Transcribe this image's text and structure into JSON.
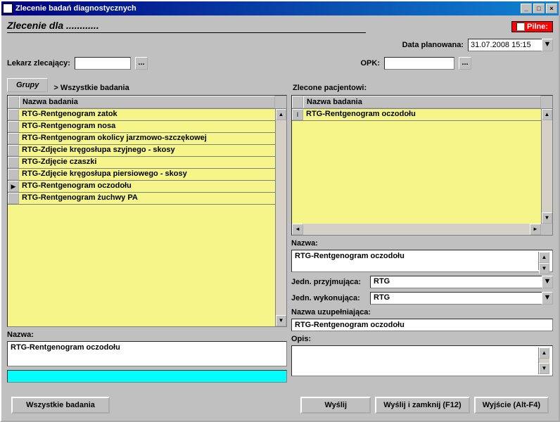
{
  "window": {
    "title": "Zlecenie badań diagnostycznych"
  },
  "header": {
    "zlecenie_dla": "Zlecenie dla ............",
    "pilne_label": "Pilne:",
    "data_plan_label": "Data planowana:",
    "data_plan_value": "31.07.2008 15:15",
    "lekarz_label": "Lekarz zlecający:",
    "lekarz_value": "",
    "opk_label": "OPK:",
    "opk_value": ""
  },
  "tabs": {
    "grupy": "Grupy",
    "breadcrumb": "> Wszystkie badania",
    "zlecone_label": "Zlecone pacjentowi:"
  },
  "left_grid": {
    "header": "Nazwa badania",
    "rows": [
      "RTG-Rentgenogram zatok",
      "RTG-Rentgenogram nosa",
      "RTG-Rentgenogram okolicy jarzmowo-szczękowej",
      "RTG-Zdjęcie kręgosłupa szyjnego - skosy",
      "RTG-Zdjęcie czaszki",
      "RTG-Zdjęcie kręgosłupa piersiowego - skosy",
      "RTG-Rentgenogram oczodołu",
      "RTG-Rentgenogram żuchwy PA"
    ],
    "selected_index": 6
  },
  "right_grid": {
    "header": "Nazwa badania",
    "rows": [
      "RTG-Rentgenogram oczodołu"
    ]
  },
  "left_fields": {
    "nazwa_label": "Nazwa:",
    "nazwa_value": "RTG-Rentgenogram oczodołu"
  },
  "right_fields": {
    "nazwa_label": "Nazwa:",
    "nazwa_value": "RTG-Rentgenogram oczodołu",
    "jedn_przyj_label": "Jedn. przyjmująca:",
    "jedn_przyj_value": "RTG",
    "jedn_wyk_label": "Jedn. wykonująca:",
    "jedn_wyk_value": "RTG",
    "nazwa_uzup_label": "Nazwa uzupełniająca:",
    "nazwa_uzup_value": "RTG-Rentgenogram oczodołu",
    "opis_label": "Opis:",
    "opis_value": ""
  },
  "buttons": {
    "wszystkie": "Wszystkie badania",
    "wyslij": "Wyślij",
    "wyslij_zamknij": "Wyślij i zamknij (F12)",
    "wyjscie": "Wyjście (Alt-F4)"
  }
}
